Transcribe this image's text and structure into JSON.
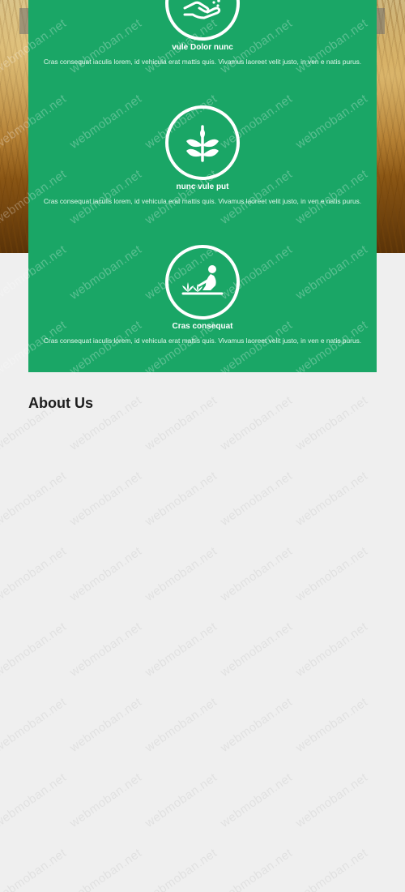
{
  "services": [
    {
      "title": "vule Dolor nunc",
      "description": "Cras consequat iaculis lorem, id vehicula erat mattis quis. Vivamus laoreet velit justo, in ven e natis purus.",
      "icon": "hand-watering-plant-icon"
    },
    {
      "title": "nunc vule put",
      "description": "Cras consequat iaculis lorem, id vehicula erat mattis quis. Vivamus laoreet velit justo, in ven e natis purus.",
      "icon": "leaf-sprout-icon"
    },
    {
      "title": "Cras consequat",
      "description": "Cras consequat iaculis lorem, id vehicula erat mattis quis. Vivamus laoreet velit justo, in ven e natis purus.",
      "icon": "farmer-planting-icon"
    }
  ],
  "about": {
    "heading": "About Us"
  },
  "watermark": {
    "text": "webmoban.net"
  },
  "colors": {
    "panel": "#1aa666",
    "background": "#efefef",
    "heading": "#1d1d1d"
  }
}
